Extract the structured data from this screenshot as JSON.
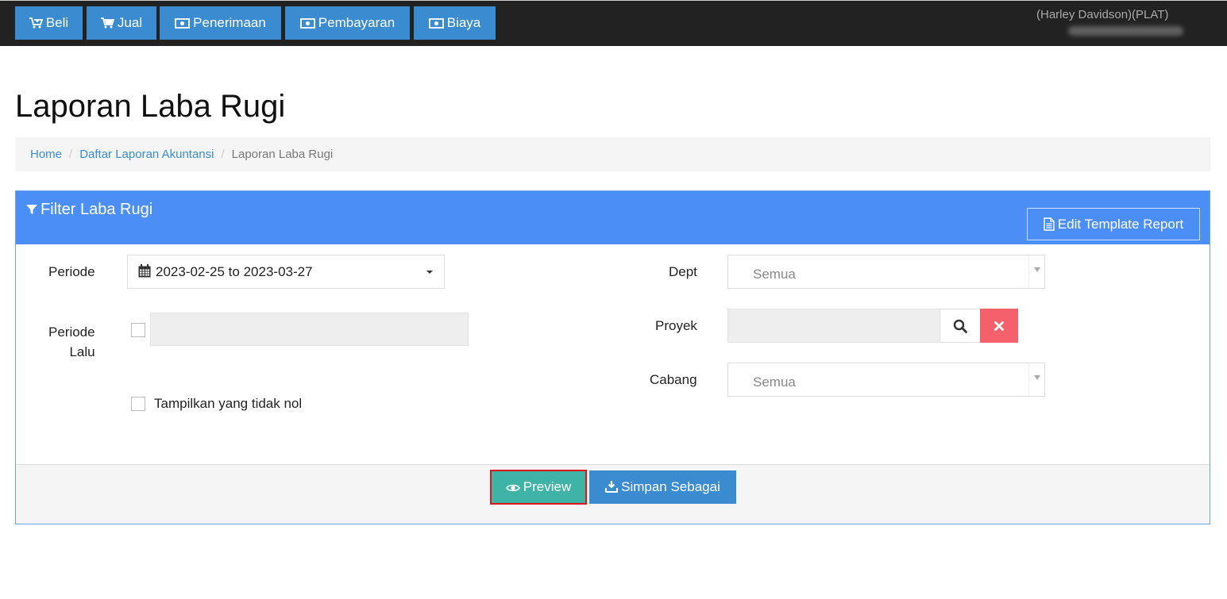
{
  "topnav": {
    "items": [
      {
        "label": "Beli",
        "icon": "cart-plus-icon"
      },
      {
        "label": "Jual",
        "icon": "cart-icon"
      },
      {
        "label": "Penerimaan",
        "icon": "money-icon"
      },
      {
        "label": "Pembayaran",
        "icon": "money-icon"
      },
      {
        "label": "Biaya",
        "icon": "money-icon"
      }
    ],
    "user": "(Harley Davidson)(PLAT)"
  },
  "page": {
    "title": "Laporan Laba Rugi"
  },
  "breadcrumb": {
    "items": [
      "Home",
      "Daftar Laporan Akuntansi",
      "Laporan Laba Rugi"
    ]
  },
  "filter": {
    "title": "Filter Laba Rugi",
    "edit_label": "Edit Template Report",
    "periode_label": "Periode",
    "periode_value": "2023-02-25 to 2023-03-27",
    "periode_lalu_label_1": "Periode",
    "periode_lalu_label_2": "Lalu",
    "show_nonzero_label": "Tampilkan yang tidak nol",
    "dept_label": "Dept",
    "dept_value": "Semua",
    "proyek_label": "Proyek",
    "cabang_label": "Cabang",
    "cabang_value": "Semua"
  },
  "actions": {
    "preview_label": "Preview",
    "save_label": "Simpan Sebagai"
  },
  "colors": {
    "nav_button": "#3a8bd0",
    "panel_header": "#4b8ef5",
    "preview": "#3fb4a6",
    "danger": "#f4606b"
  }
}
